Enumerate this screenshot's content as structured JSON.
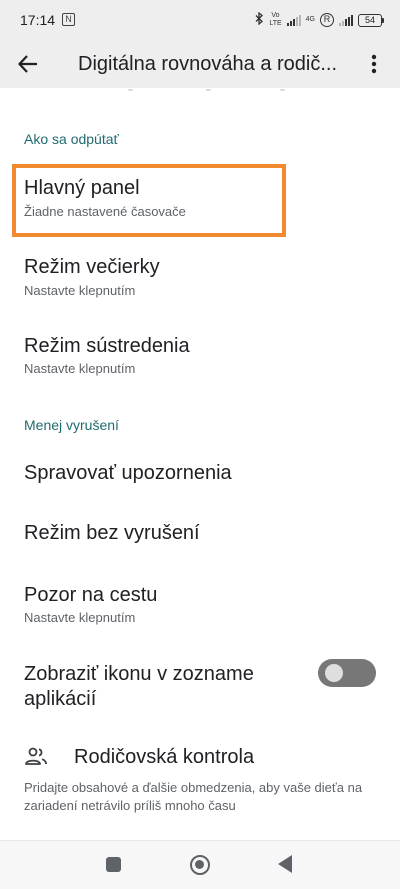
{
  "status_bar": {
    "time": "17:14",
    "nfc_glyph": "N",
    "bluetooth_icon": "bluetooth-icon",
    "volte_top": "Vo",
    "volte_bottom": "LTE",
    "network_type": "4G",
    "roaming": "R",
    "battery": "54"
  },
  "app_bar": {
    "title": "Digitálna rovnováha a rodič..."
  },
  "sections": {
    "disconnect_header": "Ako sa odpútať",
    "less_distraction_header": "Menej vyrušení"
  },
  "items": {
    "dashboard": {
      "title": "Hlavný panel",
      "subtitle": "Žiadne nastavené časovače"
    },
    "bedtime": {
      "title": "Režim večierky",
      "subtitle": "Nastavte klepnutím"
    },
    "focus": {
      "title": "Režim sústredenia",
      "subtitle": "Nastavte klepnutím"
    },
    "notifications": {
      "title": "Spravovať upozornenia"
    },
    "dnd": {
      "title": "Režim bez vyrušení"
    },
    "heads_up": {
      "title": "Pozor na cestu",
      "subtitle": "Nastavte klepnutím"
    },
    "show_icon": {
      "title_line1": "Zobraziť ikonu v zozname",
      "title_line2": "aplikácií",
      "toggle_on": false
    }
  },
  "parental": {
    "title": "Rodičovská kontrola",
    "description": "Pridajte obsahové a ďalšie obmedzenia, aby vaše dieťa na zariadení netrávilo príliš mnoho času"
  },
  "colors": {
    "accent": "#206b6f",
    "highlight": "#f28b2f"
  }
}
